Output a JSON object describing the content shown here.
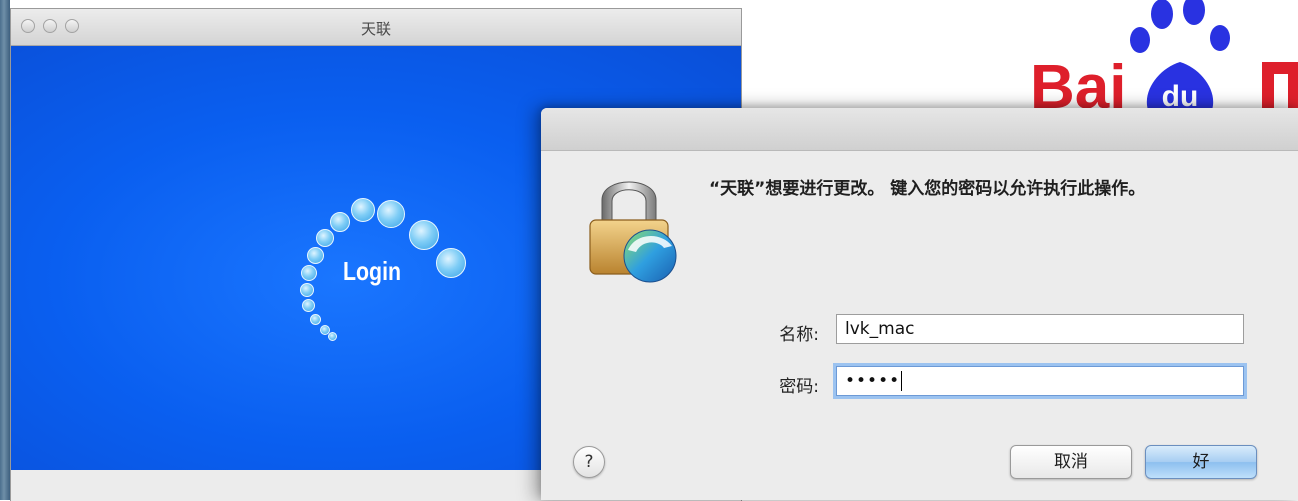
{
  "background_window": {
    "title": "天联",
    "splash_text": "Login"
  },
  "baidu_logo": {
    "text_left": "Bai",
    "paw_text": "du",
    "colors": {
      "red": "#de1f2b",
      "blue": "#2932e1"
    }
  },
  "dialog": {
    "message": "“天联”想要进行更改。 键入您的密码以允许执行此操作。",
    "name_label": "名称:",
    "name_value": "lvk_mac",
    "password_label": "密码:",
    "password_value": "•••••",
    "help_label": "?",
    "cancel_label": "取消",
    "ok_label": "好",
    "icon": "padlock-icon"
  }
}
